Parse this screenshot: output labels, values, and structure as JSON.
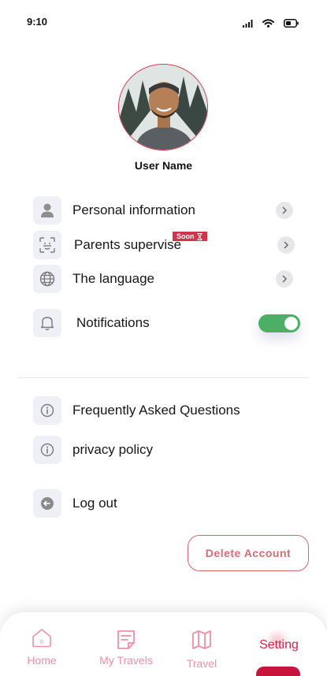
{
  "status_bar": {
    "time": "9:10"
  },
  "profile": {
    "user_name": "User Name"
  },
  "menu": {
    "personal_information": "Personal information",
    "parents_supervise": "Parents supervise",
    "soon_badge": "Soon",
    "language": "The language",
    "notifications": "Notifications",
    "notifications_enabled": true,
    "faq": "Frequently Asked Questions",
    "privacy_policy": "privacy policy",
    "log_out": "Log out"
  },
  "delete_account": "Delete Account",
  "bottom_nav": {
    "home": "Home",
    "my_travels": "My Travels",
    "travel": "Travel",
    "setting": "Setting",
    "active": "Setting"
  },
  "colors": {
    "accent": "#d4344a",
    "toggle_on": "#4caf65",
    "nav_inactive": "#ef8fa6",
    "icon_bg": "#eef0f6"
  }
}
